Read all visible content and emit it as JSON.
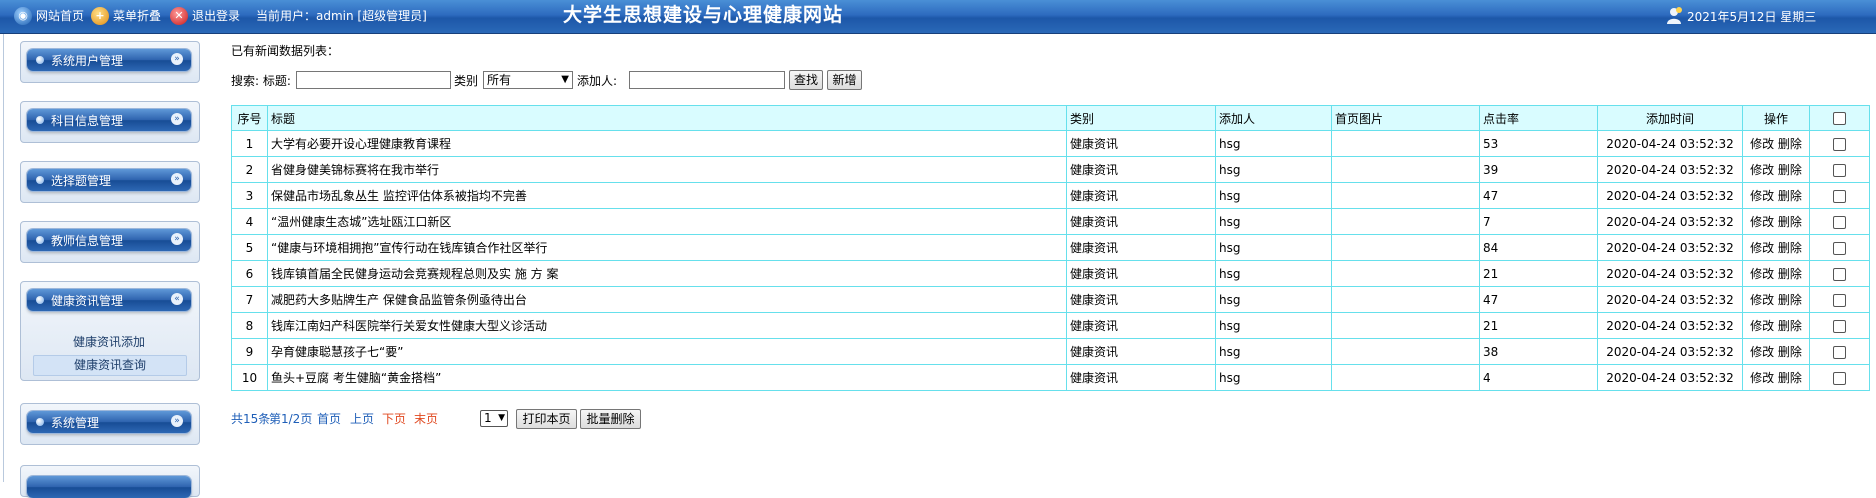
{
  "topbar": {
    "home_label": "网站首页",
    "menu_fold_label": "菜单折叠",
    "logout_label": "退出登录",
    "current_user_label": "当前用户：admin [超级管理员]",
    "site_title": "大学生思想建设与心理健康网站",
    "date_text": "2021年5月12日 星期三"
  },
  "sidebar": {
    "menus": [
      {
        "label": "系统用户管理",
        "toggle": "»"
      },
      {
        "label": "科目信息管理",
        "toggle": "»"
      },
      {
        "label": "选择题管理",
        "toggle": "»"
      },
      {
        "label": "教师信息管理",
        "toggle": "»"
      },
      {
        "label": "健康资讯管理",
        "toggle": "«",
        "items": [
          "健康资讯添加",
          "健康资讯查询"
        ]
      },
      {
        "label": "系统管理",
        "toggle": "»"
      }
    ]
  },
  "main": {
    "heading": "已有新闻数据列表：",
    "search": {
      "search_label": "搜索: 标题:",
      "title_value": "",
      "category_label": "类别",
      "category_selected": "所有",
      "adder_label": "添加人:",
      "adder_value": "",
      "find_button": "查找",
      "new_button": "新增"
    },
    "table": {
      "columns": [
        "序号",
        "标题",
        "类别",
        "添加人",
        "首页图片",
        "点击率",
        "添加时间",
        "操作"
      ],
      "edit_label": "修改",
      "delete_label": "删除",
      "rows": [
        {
          "no": "1",
          "title": "大学有必要开设心理健康教育课程",
          "category": "健康资讯",
          "adder": "hsg",
          "image": "",
          "clicks": "53",
          "time": "2020-04-24 03:52:32"
        },
        {
          "no": "2",
          "title": "省健身健美锦标赛将在我市举行",
          "category": "健康资讯",
          "adder": "hsg",
          "image": "",
          "clicks": "39",
          "time": "2020-04-24 03:52:32"
        },
        {
          "no": "3",
          "title": "保健品市场乱象丛生 监控评估体系被指均不完善",
          "category": "健康资讯",
          "adder": "hsg",
          "image": "",
          "clicks": "47",
          "time": "2020-04-24 03:52:32"
        },
        {
          "no": "4",
          "title": "“温州健康生态城”选址瓯江口新区",
          "category": "健康资讯",
          "adder": "hsg",
          "image": "",
          "clicks": "7",
          "time": "2020-04-24 03:52:32"
        },
        {
          "no": "5",
          "title": "“健康与环境相拥抱”宣传行动在钱库镇合作社区举行",
          "category": "健康资讯",
          "adder": "hsg",
          "image": "",
          "clicks": "84",
          "time": "2020-04-24 03:52:32"
        },
        {
          "no": "6",
          "title": "钱库镇首届全民健身运动会竞赛规程总则及实 施 方 案",
          "category": "健康资讯",
          "adder": "hsg",
          "image": "",
          "clicks": "21",
          "time": "2020-04-24 03:52:32"
        },
        {
          "no": "7",
          "title": "减肥药大多贴牌生产 保健食品监管条例亟待出台",
          "category": "健康资讯",
          "adder": "hsg",
          "image": "",
          "clicks": "47",
          "time": "2020-04-24 03:52:32"
        },
        {
          "no": "8",
          "title": "钱库江南妇产科医院举行关爱女性健康大型义诊活动",
          "category": "健康资讯",
          "adder": "hsg",
          "image": "",
          "clicks": "21",
          "time": "2020-04-24 03:52:32"
        },
        {
          "no": "9",
          "title": "孕育健康聪慧孩子七“要”",
          "category": "健康资讯",
          "adder": "hsg",
          "image": "",
          "clicks": "38",
          "time": "2020-04-24 03:52:32"
        },
        {
          "no": "10",
          "title": "鱼头+豆腐 考生健脑“黄金搭档”",
          "category": "健康资讯",
          "adder": "hsg",
          "image": "",
          "clicks": "4",
          "time": "2020-04-24 03:52:32"
        }
      ]
    },
    "pager": {
      "total": "共15条",
      "page_info": "第1/2页",
      "first": "首页",
      "prev": "上页",
      "next": "下页",
      "last": "末页",
      "page_selected": "1",
      "print_button": "打印本页",
      "batch_delete_button": "批量删除"
    }
  }
}
